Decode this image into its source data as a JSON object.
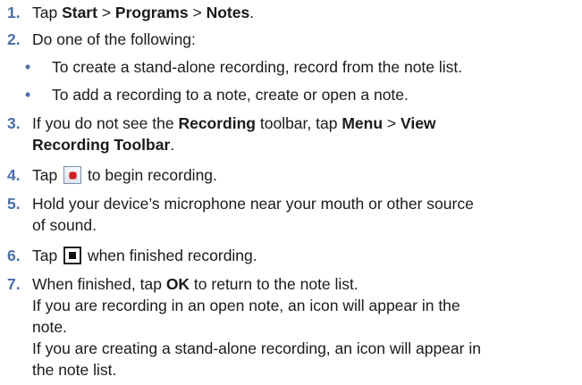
{
  "steps": [
    {
      "number": "1.",
      "parts": [
        "Tap ",
        "Start",
        " > ",
        "Programs",
        " > ",
        "Notes",
        "."
      ]
    },
    {
      "number": "2.",
      "text": "Do one of the following:",
      "bullets": [
        "To create a stand-alone recording, record from the note list.",
        "To add a recording to a note, create or open a note."
      ]
    },
    {
      "number": "3.",
      "parts": [
        "If you do not see the ",
        "Recording",
        " toolbar, tap ",
        "Menu",
        " > ",
        "View",
        "Recording Toolbar",
        "."
      ]
    },
    {
      "number": "4.",
      "before": "Tap ",
      "icon": "record-icon",
      "after": " to begin recording."
    },
    {
      "number": "5.",
      "lines": [
        "Hold your device’s microphone near your mouth or other source",
        "of sound."
      ]
    },
    {
      "number": "6.",
      "before": "Tap ",
      "icon": "stop-icon",
      "after": " when finished recording."
    },
    {
      "number": "7.",
      "parts": [
        "When finished, tap ",
        "OK",
        " to return to the note list."
      ],
      "extra_lines": [
        "If you are recording in an open note, an icon will appear in the",
        "note.",
        "If you are creating a stand-alone recording, an icon will appear in",
        "the note list."
      ]
    }
  ],
  "bullet_char": "•",
  "colors": {
    "accent": "#4a6fa3",
    "text": "#1a1a1a",
    "record": "#cc1d22"
  }
}
